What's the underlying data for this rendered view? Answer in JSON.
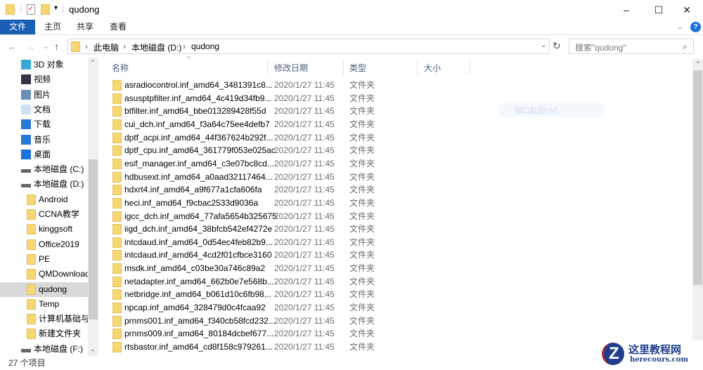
{
  "window": {
    "title": "qudong",
    "minimize": "–",
    "maximize": "☐",
    "close": "✕"
  },
  "ribbon": {
    "tabs": [
      "文件",
      "主页",
      "共享",
      "查看"
    ],
    "help": "?"
  },
  "address": {
    "crumbs": [
      "此电脑",
      "本地磁盘 (D:)",
      "qudong"
    ],
    "search_placeholder": "搜索\"qudong\""
  },
  "sidebar": {
    "items": [
      {
        "label": "3D 对象",
        "icon": "3d-objects-icon"
      },
      {
        "label": "视频",
        "icon": "video-icon"
      },
      {
        "label": "图片",
        "icon": "pictures-icon"
      },
      {
        "label": "文档",
        "icon": "documents-icon"
      },
      {
        "label": "下载",
        "icon": "download-icon"
      },
      {
        "label": "音乐",
        "icon": "music-icon"
      },
      {
        "label": "桌面",
        "icon": "desktop-icon"
      },
      {
        "label": "本地磁盘 (C:)",
        "icon": "drive-icon"
      },
      {
        "label": "本地磁盘 (D:)",
        "icon": "drive-icon"
      },
      {
        "label": "Android",
        "icon": "folder-icon"
      },
      {
        "label": "CCNA教学",
        "icon": "folder-icon"
      },
      {
        "label": "kinggsoft",
        "icon": "folder-icon"
      },
      {
        "label": "Office2019",
        "icon": "folder-icon"
      },
      {
        "label": "PE",
        "icon": "folder-icon"
      },
      {
        "label": "QMDownload",
        "icon": "folder-icon"
      },
      {
        "label": "qudong",
        "icon": "folder-icon",
        "selected": true
      },
      {
        "label": "Temp",
        "icon": "folder-icon"
      },
      {
        "label": "计算机基础与应",
        "icon": "folder-icon"
      },
      {
        "label": "新建文件夹",
        "icon": "folder-icon"
      },
      {
        "label": "本地磁盘 (F:)",
        "icon": "drive-icon"
      }
    ]
  },
  "columns": {
    "name": "名称",
    "date": "修改日期",
    "type": "类型",
    "size": "大小"
  },
  "files": [
    {
      "name": "asradiocontrol.inf_amd64_3481391c8...",
      "date": "2020/1/27 11:45",
      "type": "文件夹"
    },
    {
      "name": "asusptpfilter.inf_amd64_4c419d34fb9...",
      "date": "2020/1/27 11:45",
      "type": "文件夹"
    },
    {
      "name": "btfilter.inf_amd64_bbe013289428f55d",
      "date": "2020/1/27 11:45",
      "type": "文件夹"
    },
    {
      "name": "cui_dch.inf_amd64_f3a64c75ee4defb7",
      "date": "2020/1/27 11:45",
      "type": "文件夹"
    },
    {
      "name": "dptf_acpi.inf_amd64_44f367624b292f...",
      "date": "2020/1/27 11:45",
      "type": "文件夹"
    },
    {
      "name": "dptf_cpu.inf_amd64_361779f053e025ac",
      "date": "2020/1/27 11:45",
      "type": "文件夹"
    },
    {
      "name": "esif_manager.inf_amd64_c3e07bc8cd...",
      "date": "2020/1/27 11:45",
      "type": "文件夹"
    },
    {
      "name": "hdbusext.inf_amd64_a0aad32117464...",
      "date": "2020/1/27 11:45",
      "type": "文件夹"
    },
    {
      "name": "hdxrt4.inf_amd64_a9f677a1cfa606fa",
      "date": "2020/1/27 11:45",
      "type": "文件夹"
    },
    {
      "name": "heci.inf_amd64_f9cbac2533d9036a",
      "date": "2020/1/27 11:45",
      "type": "文件夹"
    },
    {
      "name": "igcc_dch.inf_amd64_77afa5654b325675",
      "date": "2020/1/27 11:45",
      "type": "文件夹"
    },
    {
      "name": "iigd_dch.inf_amd64_38bfcb542ef4272e",
      "date": "2020/1/27 11:45",
      "type": "文件夹"
    },
    {
      "name": "intcdaud.inf_amd64_0d54ec4feb82b9...",
      "date": "2020/1/27 11:45",
      "type": "文件夹"
    },
    {
      "name": "intcdaud.inf_amd64_4cd2f01cfbce3160",
      "date": "2020/1/27 11:45",
      "type": "文件夹"
    },
    {
      "name": "msdk.inf_amd64_c03be30a746c89a2",
      "date": "2020/1/27 11:45",
      "type": "文件夹"
    },
    {
      "name": "netadapter.inf_amd64_662b0e7e568b...",
      "date": "2020/1/27 11:45",
      "type": "文件夹"
    },
    {
      "name": "netbridge.inf_amd64_b061d10c6fb98...",
      "date": "2020/1/27 11:45",
      "type": "文件夹"
    },
    {
      "name": "npcap.inf_amd64_328479d0c4fcaa92",
      "date": "2020/1/27 11:45",
      "type": "文件夹"
    },
    {
      "name": "prnms001.inf_amd64_f340cb58fcd232...",
      "date": "2020/1/27 11:45",
      "type": "文件夹"
    },
    {
      "name": "prnms009.inf_amd64_80184dcbef677...",
      "date": "2020/1/27 11:45",
      "type": "文件夹"
    },
    {
      "name": "rtsbastor.inf_amd64_cd8f158c979261...",
      "date": "2020/1/27 11:45",
      "type": "文件夹"
    }
  ],
  "status": {
    "count": "27 个项目"
  },
  "ghost_tooltip": "窗口截图(W)",
  "watermark": {
    "title": "这里教程网",
    "url": "herecours.com"
  },
  "colors": {
    "accent": "#1a5fb4",
    "folder": "#f7d774",
    "selected": "#d9d9d9"
  }
}
